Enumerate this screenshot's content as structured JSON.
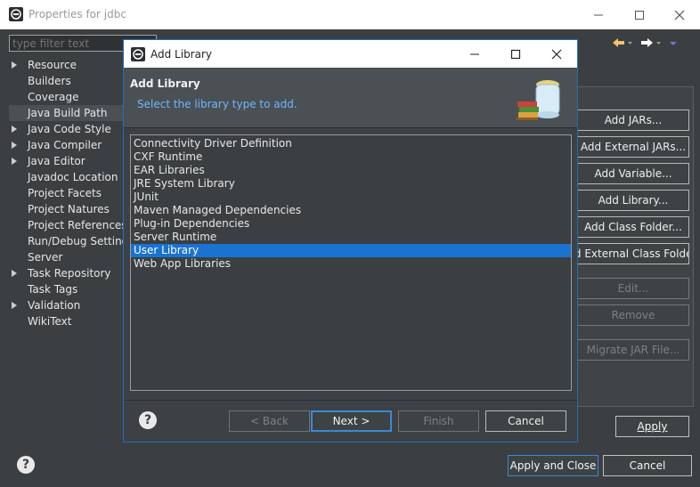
{
  "outer": {
    "title": "Properties for jdbc",
    "filter_placeholder": "type filter text",
    "nav": [
      {
        "label": "Resource",
        "expandable": true
      },
      {
        "label": "Builders",
        "expandable": false
      },
      {
        "label": "Coverage",
        "expandable": false
      },
      {
        "label": "Java Build Path",
        "expandable": false,
        "selected": true
      },
      {
        "label": "Java Code Style",
        "expandable": true
      },
      {
        "label": "Java Compiler",
        "expandable": true
      },
      {
        "label": "Java Editor",
        "expandable": true
      },
      {
        "label": "Javadoc Location",
        "expandable": false
      },
      {
        "label": "Project Facets",
        "expandable": false
      },
      {
        "label": "Project Natures",
        "expandable": false
      },
      {
        "label": "Project References",
        "expandable": false
      },
      {
        "label": "Run/Debug Settings",
        "expandable": false
      },
      {
        "label": "Server",
        "expandable": false
      },
      {
        "label": "Task Repository",
        "expandable": true
      },
      {
        "label": "Task Tags",
        "expandable": false
      },
      {
        "label": "Validation",
        "expandable": true
      },
      {
        "label": "WikiText",
        "expandable": false
      }
    ],
    "side_buttons": [
      {
        "label": "Add JARs...",
        "enabled": true
      },
      {
        "label": "Add External JARs...",
        "enabled": true
      },
      {
        "label": "Add Variable...",
        "enabled": true
      },
      {
        "label": "Add Library...",
        "enabled": true
      },
      {
        "label": "Add Class Folder...",
        "enabled": true
      },
      {
        "label": "Add External Class Folder...",
        "enabled": true
      },
      {
        "label": "Edit...",
        "enabled": false
      },
      {
        "label": "Remove",
        "enabled": false
      },
      {
        "label": "Migrate JAR File...",
        "enabled": false
      }
    ],
    "apply_label": "Apply",
    "apply_close_label": "Apply and Close",
    "cancel_label": "Cancel"
  },
  "dialog": {
    "title": "Add Library",
    "header_title": "Add Library",
    "header_subtitle": "Select the library type to add.",
    "libraries": [
      "Connectivity Driver Definition",
      "CXF Runtime",
      "EAR Libraries",
      "JRE System Library",
      "JUnit",
      "Maven Managed Dependencies",
      "Plug-in Dependencies",
      "Server Runtime",
      "User Library",
      "Web App Libraries"
    ],
    "selected_library": "User Library",
    "back_label": "< Back",
    "next_label": "Next >",
    "finish_label": "Finish",
    "cancel_label": "Cancel"
  },
  "icons": {
    "app": "eclipse-icon",
    "help": "help-icon",
    "back": "back-arrow-icon",
    "forward": "forward-arrow-icon",
    "menu": "view-menu-icon",
    "wizard": "library-jar-icon"
  },
  "colors": {
    "accent": "#1a73d0",
    "subtitle": "#6fb6ff",
    "background": "#3b3f42"
  }
}
